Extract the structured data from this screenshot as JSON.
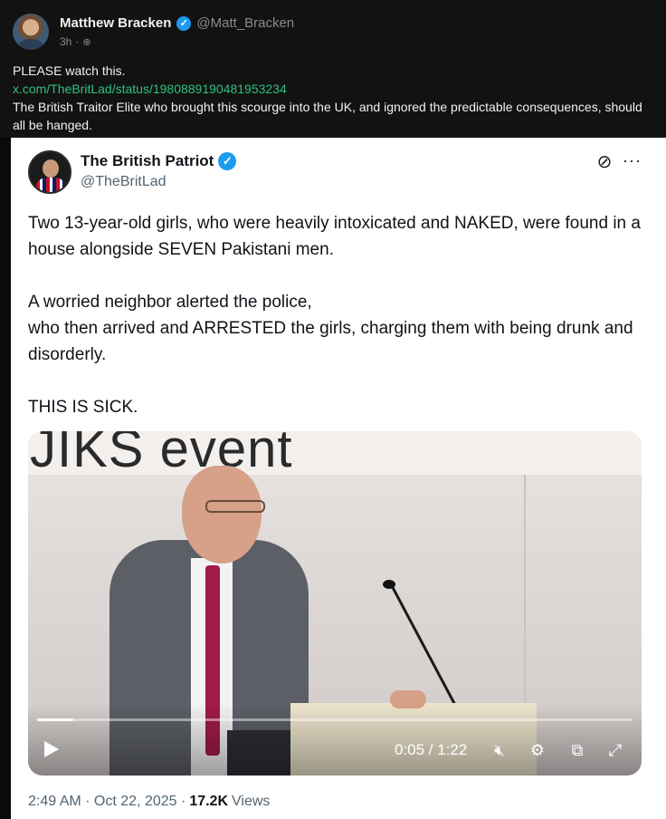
{
  "post": {
    "author_name": "Matthew Bracken",
    "author_handle": "@Matt_Bracken",
    "time_ago": "3h",
    "line1": "PLEASE watch this.",
    "link": "x.com/TheBritLad/status/1980889190481953234",
    "line2": "The British Traitor Elite who brought this scourge into the UK, and ignored the predictable consequences, should all be hanged."
  },
  "embedded_tweet": {
    "author_name": "The British Patriot",
    "author_handle": "@TheBritLad",
    "paragraph1": "Two 13-year-old girls, who were heavily intoxicated and NAKED, were found in a house alongside SEVEN Pakistani men.",
    "paragraph2a": "A worried neighbor alerted the police,",
    "paragraph2b": "who then arrived and ARRESTED the girls, charging them with being drunk and disorderly.",
    "paragraph3": "THIS IS SICK.",
    "video": {
      "banner_text": "JIKS event",
      "current_time": "0:05",
      "duration": "1:22",
      "time_display": "0:05 / 1:22",
      "progress_fraction": 0.061
    },
    "timestamp": "2:49 AM · Oct 22, 2025 ·",
    "views_count": "17.2K",
    "views_label": "Views"
  },
  "icons": {
    "verified": "verified-check-icon",
    "globe": "globe-icon",
    "grok": "grok-icon",
    "more": "more-options-icon",
    "play": "play-icon",
    "mute": "mute-icon",
    "settings": "gear-icon",
    "pip": "picture-in-picture-icon",
    "fullscreen": "fullscreen-icon"
  },
  "colors": {
    "link": "#2ec27e",
    "verified": "#1d9bf0",
    "tie": "#a11a4a"
  }
}
